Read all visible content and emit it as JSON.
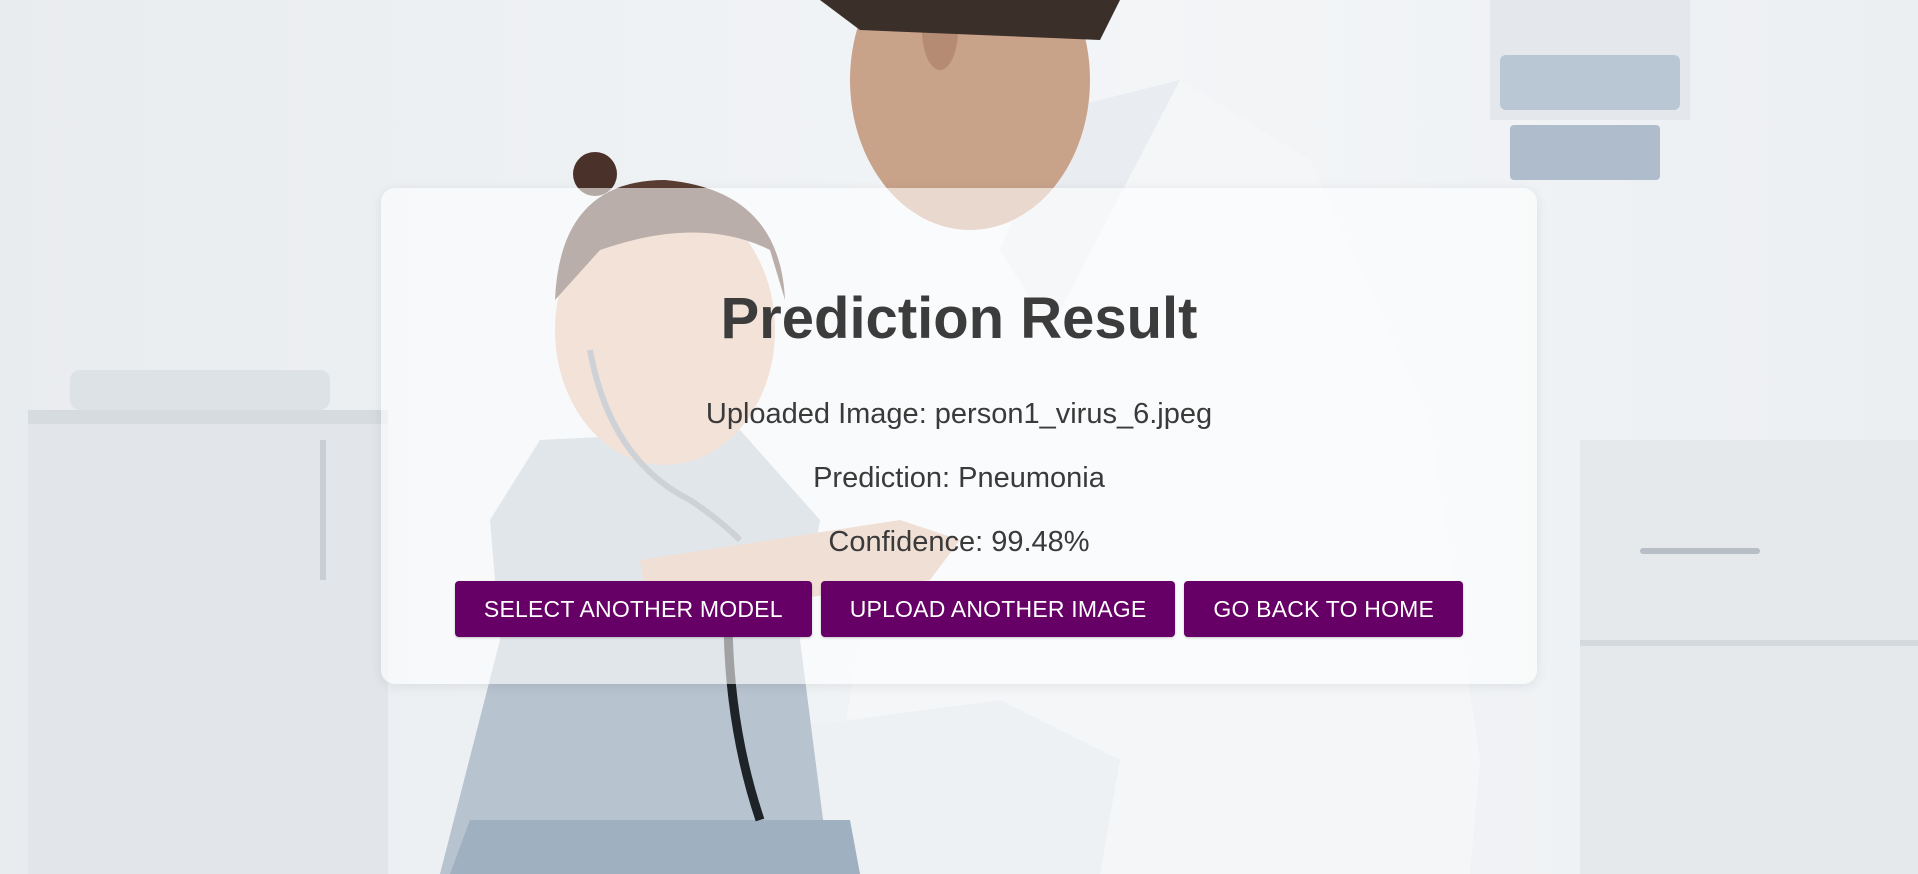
{
  "page": {
    "title": "Prediction Result",
    "uploaded_label": "Uploaded Image: person1_virus_6.jpeg",
    "prediction_label": "Prediction: Pneumonia",
    "confidence_label": "Confidence: 99.48%"
  },
  "buttons": {
    "select_model": "SELECT ANOTHER MODEL",
    "upload_image": "UPLOAD ANOTHER IMAGE",
    "go_home": "GO BACK TO HOME"
  },
  "colors": {
    "button_bg": "#660066",
    "button_text": "#ffffff",
    "title_text": "#3c3c3c",
    "card_bg": "rgba(255,255,255,0.58)"
  }
}
